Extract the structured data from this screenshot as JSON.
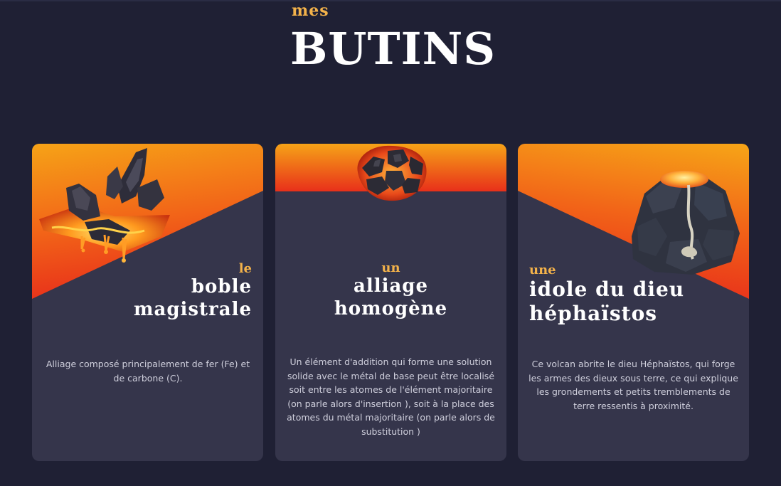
{
  "heading": {
    "pre": "mes",
    "main": "BUTINS"
  },
  "cards": [
    {
      "pre": "le",
      "title_lines": [
        "boble",
        "magistrale"
      ],
      "description": "Alliage composé principalement de fer (Fe) et de carbone (C).",
      "image": "lava-rock-shard-icon"
    },
    {
      "pre": "un",
      "title_lines": [
        "alliage",
        "homogène"
      ],
      "description": "Un élément d'addition qui forme une solution solide avec le métal de base peut être localisé soit entre les atomes de l'élément majoritaire (on parle alors d'insertion ), soit à la place des atomes du métal majoritaire (on parle alors de substitution )",
      "image": "molten-rock-icon"
    },
    {
      "pre": "une",
      "title_lines": [
        "idole du dieu",
        "héphaïstos"
      ],
      "description": "Ce volcan abrite le dieu Héphaïstos, qui forge les armes des dieux sous terre, ce qui explique les grondements et petits tremblements de terre ressentis à proximité.",
      "image": "volcano-idol-icon"
    }
  ],
  "colors": {
    "background": "#1f2034",
    "card": "#35354b",
    "accent": "#f3b24a",
    "lava_top": "#f6a317",
    "lava_bottom": "#e8301a"
  }
}
